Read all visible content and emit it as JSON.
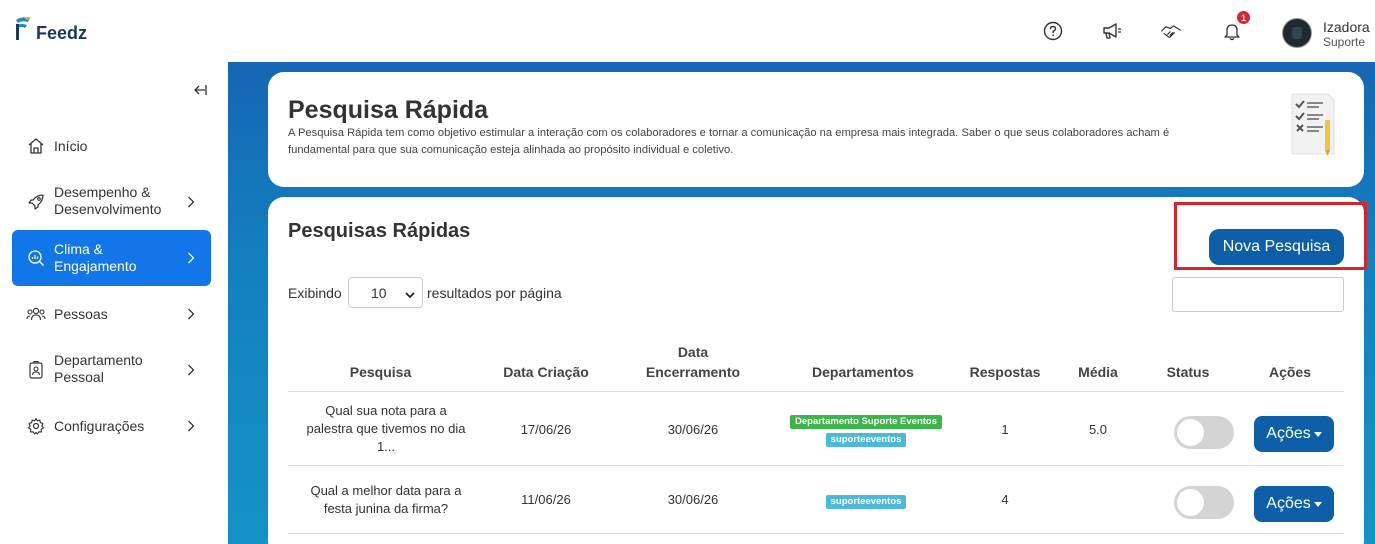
{
  "app": {
    "logo_text": "Feedz"
  },
  "header": {
    "icons": [
      "help-icon",
      "megaphone-icon",
      "handshake-icon",
      "bell-icon"
    ],
    "notification_count": "1",
    "user": {
      "name": "Izadora",
      "role": "Suporte"
    }
  },
  "sidebar": {
    "items": [
      {
        "label": "Início",
        "icon": "home-icon"
      },
      {
        "label": "Desempenho & Desenvolvimento",
        "line1": "Desempenho &",
        "line2": "Desenvolvimento",
        "icon": "rocket-icon"
      },
      {
        "label": "Clima & Engajamento",
        "line1": "Clima &",
        "line2": "Engajamento",
        "icon": "search-chart-icon",
        "active": true
      },
      {
        "label": "Pessoas",
        "icon": "people-icon"
      },
      {
        "label": "Departamento Pessoal",
        "line1": "Departamento",
        "line2": "Pessoal",
        "icon": "badge-icon"
      },
      {
        "label": "Configurações",
        "icon": "gear-icon"
      }
    ]
  },
  "intro": {
    "title": "Pesquisa Rápida",
    "description": "A Pesquisa Rápida tem como objetivo estimular a interação com os colaboradores e tornar a comunicação na empresa mais integrada. Saber o que seus colaboradores acham é fundamental para que sua comunicação esteja alinhada ao propósito individual e coletivo."
  },
  "list": {
    "title": "Pesquisas Rápidas",
    "new_button": "Nova Pesquisa",
    "showing_label": "Exibindo",
    "page_size": "10",
    "per_page_label": "resultados por página",
    "search_value": "",
    "columns": {
      "pesquisa": "Pesquisa",
      "data_criacao": "Data Criação",
      "data_encerramento_1": "Data",
      "data_encerramento_2": "Encerramento",
      "departamentos": "Departamentos",
      "respostas": "Respostas",
      "media": "Média",
      "status": "Status",
      "acoes": "Ações"
    },
    "rows": [
      {
        "pesquisa_1": "Qual sua nota para a",
        "pesquisa_2": "palestra que tivemos no dia",
        "pesquisa_3": "1...",
        "data_criacao": "17/06/26",
        "data_encerramento": "30/06/26",
        "departamentos": [
          "Departamento Suporte Eventos",
          "suporteeventos"
        ],
        "respostas": "1",
        "media": "5.0",
        "status_on": false,
        "acoes": "Ações"
      },
      {
        "pesquisa_1": "Qual a melhor data para a",
        "pesquisa_2": "festa junina da firma?",
        "data_criacao": "11/06/26",
        "data_encerramento": "30/06/26",
        "departamentos": [
          "suporteeventos"
        ],
        "respostas": "4",
        "media": "",
        "status_on": false,
        "acoes": "Ações"
      }
    ]
  },
  "colors": {
    "primary": "#0d5fa8",
    "active_nav": "#1275e8",
    "highlight": "#d8232b",
    "tag_green": "#3cb54a",
    "tag_cyan": "#4cb9d9"
  }
}
